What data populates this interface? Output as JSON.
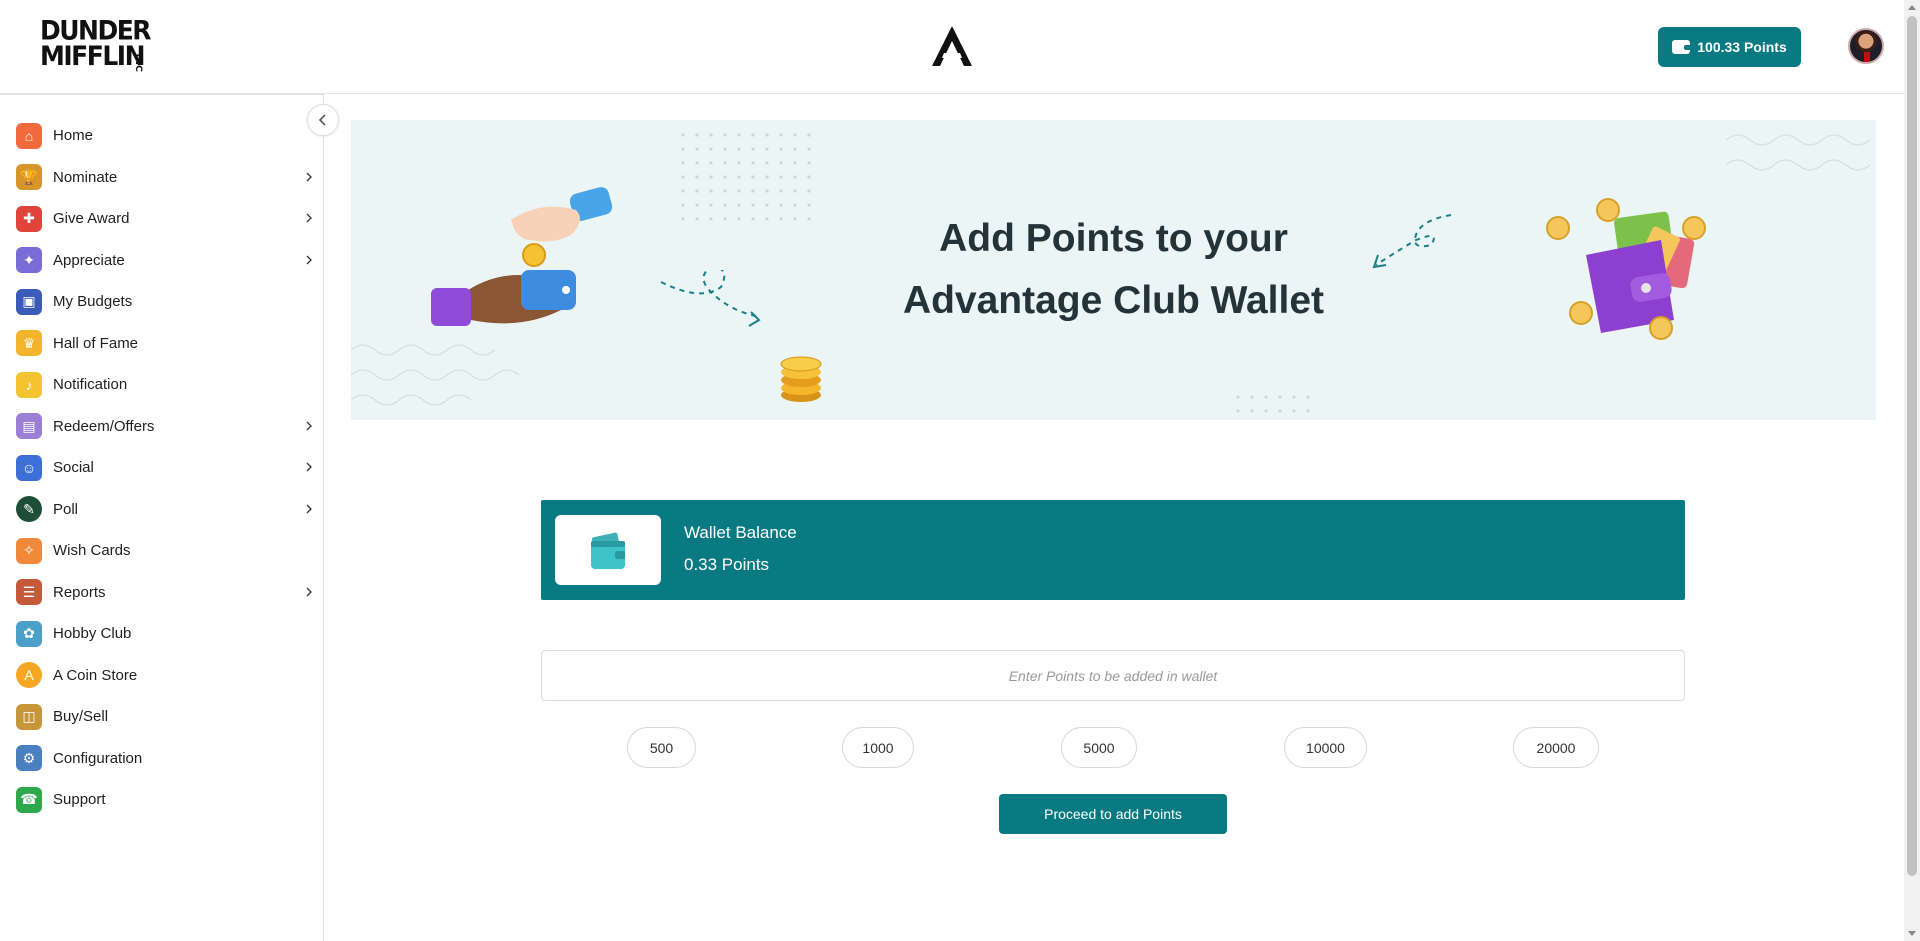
{
  "header": {
    "logo_line1": "DUNDER",
    "logo_line2": "MIFFLIN",
    "logo_inc": "INC",
    "points_label": "100.33  Points"
  },
  "sidebar": {
    "items": [
      {
        "label": "Home",
        "icon": "home-icon",
        "color": "#f06a3c",
        "has_submenu": false
      },
      {
        "label": "Nominate",
        "icon": "trophy-icon",
        "color": "#d8962a",
        "has_submenu": true
      },
      {
        "label": "Give Award",
        "icon": "gift-icon",
        "color": "#e0443a",
        "has_submenu": true
      },
      {
        "label": "Appreciate",
        "icon": "medal-icon",
        "color": "#7a6bd6",
        "has_submenu": true
      },
      {
        "label": "My Budgets",
        "icon": "budget-icon",
        "color": "#3a5bb8",
        "has_submenu": false
      },
      {
        "label": "Hall of Fame",
        "icon": "crown-icon",
        "color": "#f2b52b",
        "has_submenu": false
      },
      {
        "label": "Notification",
        "icon": "bell-icon",
        "color": "#f4c430",
        "has_submenu": false
      },
      {
        "label": "Redeem/Offers",
        "icon": "offers-icon",
        "color": "#9a7fd4",
        "has_submenu": true
      },
      {
        "label": "Social",
        "icon": "social-icon",
        "color": "#3d6fd6",
        "has_submenu": true
      },
      {
        "label": "Poll",
        "icon": "poll-icon",
        "color": "#1e4d3a",
        "has_submenu": true
      },
      {
        "label": "Wish Cards",
        "icon": "party-icon",
        "color": "#f08a3a",
        "has_submenu": false
      },
      {
        "label": "Reports",
        "icon": "clipboard-icon",
        "color": "#c45a3a",
        "has_submenu": true
      },
      {
        "label": "Hobby Club",
        "icon": "hobby-icon",
        "color": "#4aa0c8",
        "has_submenu": false
      },
      {
        "label": "A Coin Store",
        "icon": "coin-icon",
        "color": "#f5a623",
        "has_submenu": false
      },
      {
        "label": "Buy/Sell",
        "icon": "shopping-bag-icon",
        "color": "#c8963a",
        "has_submenu": false
      },
      {
        "label": "Configuration",
        "icon": "config-icon",
        "color": "#4a7fc0",
        "has_submenu": false
      },
      {
        "label": "Support",
        "icon": "phone-icon",
        "color": "#2ea84a",
        "has_submenu": false
      }
    ]
  },
  "banner": {
    "title_line1": "Add Points to your",
    "title_line2": "Advantage Club Wallet"
  },
  "wallet": {
    "title": "Wallet Balance",
    "value": "0.33 Points"
  },
  "add_points": {
    "placeholder": "Enter Points to be added in wallet",
    "presets": [
      "500",
      "1000",
      "5000",
      "10000",
      "20000"
    ],
    "proceed_label": "Proceed to add Points"
  },
  "colors": {
    "accent": "#0a7a82",
    "banner_bg": "#ebf5f5"
  }
}
